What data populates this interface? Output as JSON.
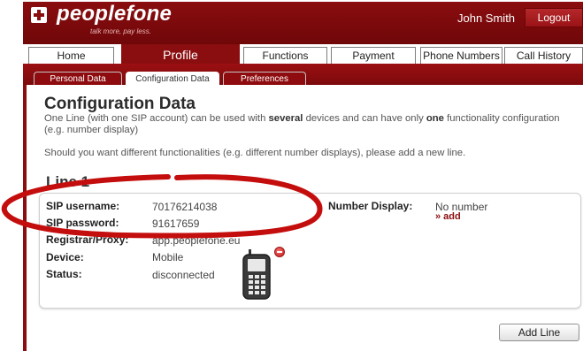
{
  "header": {
    "brand": "peoplefone",
    "tagline": "talk more, pay less.",
    "user_name": "John Smith",
    "logout_label": "Logout",
    "accent_color": "#8a0d0f"
  },
  "main_nav": {
    "tabs": [
      {
        "label": "Home"
      },
      {
        "label": "Profile",
        "active": true
      },
      {
        "label": "Functions"
      },
      {
        "label": "Payment"
      },
      {
        "label": "Phone Numbers"
      },
      {
        "label": "Call History"
      }
    ]
  },
  "sub_nav": {
    "tabs": [
      {
        "label": "Personal Data"
      },
      {
        "label": "Configuration Data",
        "active": true
      },
      {
        "label": "Preferences"
      }
    ]
  },
  "page": {
    "title": "Configuration Data",
    "intro_part1": "One Line (with one SIP account) can be used with ",
    "intro_bold1": "several",
    "intro_part2": " devices and can have only ",
    "intro_bold2": "one",
    "intro_part3": " functionality configuration (e.g. number display)",
    "advice": "Should you want different functionalities (e.g. different number displays), please add a new line."
  },
  "line": {
    "heading": "Line 1",
    "fields": [
      {
        "label": "SIP username:",
        "value": "70176214038"
      },
      {
        "label": "SIP password:",
        "value": "91617659"
      },
      {
        "label": "Registrar/Proxy:",
        "value": "app.peoplefone.eu"
      },
      {
        "label": "Device:",
        "value": "Mobile"
      },
      {
        "label": "Status:",
        "value": "disconnected"
      }
    ],
    "number_display_label": "Number Display:",
    "number_display_value": "No number",
    "add_link": "» add",
    "device_icon": "mobile-phone-icon",
    "remove_icon": "remove-device-icon"
  },
  "actions": {
    "add_line_label": "Add Line"
  },
  "annotation": {
    "color": "#c40d0d",
    "shape": "ellipse around SIP credentials"
  }
}
